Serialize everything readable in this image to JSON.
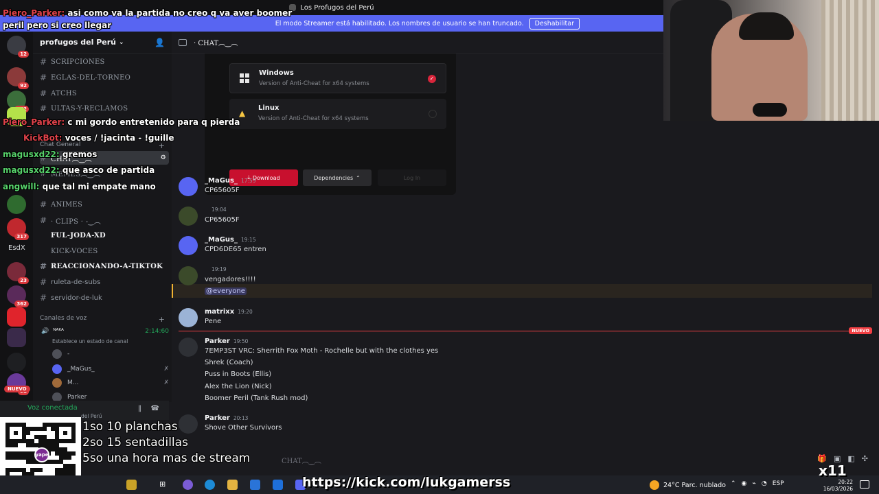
{
  "window": {
    "title": "Los Profugos del Perú",
    "streamer_notice": "El modo Streamer está habilitado. Los nombres de usuario se han truncado.",
    "disable_button": "Deshabilitar"
  },
  "server": {
    "name": "profugos del Perú",
    "channels": [
      {
        "label": "SCRIPCIONES",
        "style": "serif"
      },
      {
        "label": "EGLAS-DEL-TORNEO",
        "style": "serif"
      },
      {
        "label": "ATCHS",
        "style": "serif"
      },
      {
        "label": "ULTAS-Y-RECLAMOS",
        "style": "serif"
      }
    ],
    "category_general": "Chat General",
    "selected_channel": "CHAT︵‿︵",
    "channels2": [
      {
        "label": "MEMES︵‿︵",
        "style": "serif"
      },
      {
        "label": "ANIMES",
        "style": "serif"
      },
      {
        "label": "· CLIPS · -‿︵",
        "style": "serif"
      },
      {
        "label": "FUL-JODA-XD",
        "style": "serif-bright"
      },
      {
        "label": "KICK-VOCES",
        "style": "serif"
      },
      {
        "label": "REACCIONANDO-A-TIKTOK",
        "style": "serif-bright"
      },
      {
        "label": "ruleta-de-subs",
        "style": "sans"
      },
      {
        "label": "servidor-de-luk",
        "style": "sans"
      }
    ],
    "voice_category": "Canales de voz",
    "voice_channel": {
      "name": "ᴺᴬᴷᴬ",
      "timer": "2:14:60",
      "status": "Establece un estado de canal"
    },
    "voice_users": [
      "-",
      "_MaGus_",
      "M...",
      "Parker"
    ],
    "voice_connected": "Voz conectada",
    "voice_connected_server": "del Perú"
  },
  "rail": {
    "badges": [
      "12",
      "92",
      "262",
      "317",
      "23",
      "362",
      "52"
    ],
    "text_item": "EsdX",
    "new_label": "NUEVO"
  },
  "chat": {
    "header": "· CHAT︵‿︵",
    "embed": {
      "options": [
        {
          "name": "Windows",
          "desc": "Version of Anti-Cheat for x64 systems"
        },
        {
          "name": "Linux",
          "desc": "Version of Anti-Cheat for x64 systems"
        }
      ],
      "download": "Download",
      "dependencies": "Dependencies",
      "login": "Log In"
    },
    "messages": [
      {
        "author": "_MaGus_",
        "time": "17:59",
        "lines": [
          "CP65605F"
        ]
      },
      {
        "author": "",
        "time": "19:04",
        "lines": [
          "CP65605F"
        ]
      },
      {
        "author": "_MaGus_",
        "time": "19:15",
        "lines": [
          "CPD6DE65 entren"
        ]
      },
      {
        "author": "",
        "time": "19:19",
        "lines": [
          "vengadores!!!!"
        ],
        "mention": "@everyone"
      },
      {
        "author": "matrixx",
        "time": "19:20",
        "lines": [
          "Pene"
        ]
      },
      {
        "author": "Parker",
        "time": "19:50",
        "lines": [
          "7EMP3ST VRC: Sherrith Fox Moth - Rochelle but with the clothes yes",
          "Shrek (Coach)",
          "Puss in Boots (Ellis)",
          "Alex the Lion (Nick)",
          "Boomer Peril (Tank Rush mod)"
        ]
      },
      {
        "author": "Parker",
        "time": "20:13",
        "lines": [
          "Shove Other Survivors"
        ]
      }
    ],
    "new_label": "NUEVO",
    "composer_placeholder": "CHAT︵‿︵"
  },
  "overlay": {
    "messages": [
      {
        "user": "Piero_Parker:",
        "text": "asi como va la partida no creo q va aver boomer",
        "color": "red"
      },
      {
        "user": "",
        "text": "peril pero si creo llegar",
        "color": "red"
      },
      {
        "user": "Piero_Parker:",
        "text": "c mi gordo entretenido para q pierda",
        "color": "red"
      },
      {
        "user": "KickBot:",
        "text": "voces / !jacinta - !guille",
        "color": "red"
      },
      {
        "user": "magusxd22:",
        "text": "gremos",
        "color": "green"
      },
      {
        "user": "magusxd22:",
        "text": "que asco de partida",
        "color": "green"
      },
      {
        "user": "angwill:",
        "text": "que tal mi empate mano",
        "color": "green"
      }
    ]
  },
  "stream": {
    "goals": [
      "1so 10 planchas",
      "2so 15 sentadillas",
      "5so una hora mas de stream"
    ],
    "link": "https://kick.com/lukgamerss",
    "qr_label": "yape",
    "multiplier": "x11"
  },
  "taskbar": {
    "weather": "24°C  Parc. nublado",
    "lang": "ESP",
    "time": "20:22",
    "date": "16/03/2026"
  },
  "colors": {
    "blurple": "#5865f2",
    "danger": "#f23f43",
    "mention_bar": "#f0b232",
    "online": "#23a55a"
  }
}
